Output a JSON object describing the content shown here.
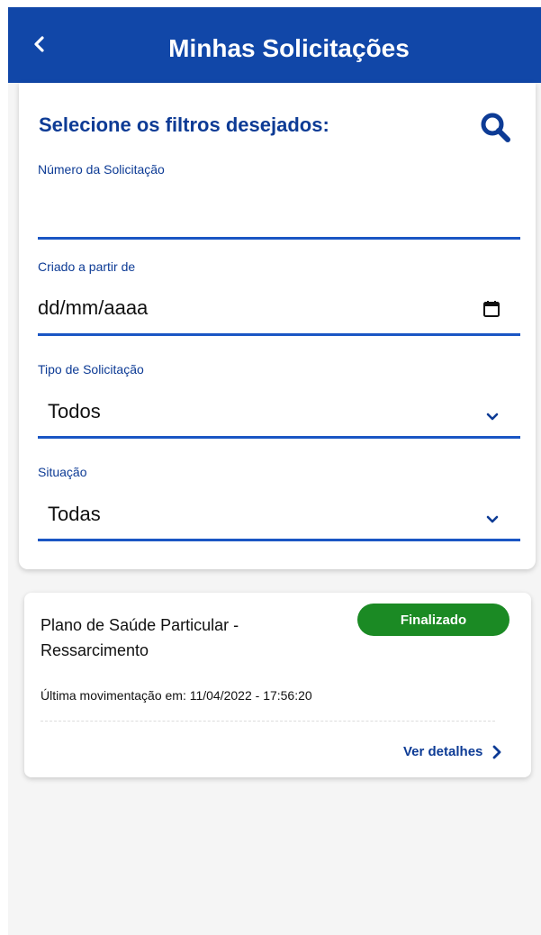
{
  "header": {
    "title": "Minhas Solicitações",
    "back_icon": "chevron-left-icon"
  },
  "filters": {
    "heading": "Selecione os filtros desejados:",
    "search_icon": "search-icon",
    "request_number": {
      "label": "Número da Solicitação",
      "value": ""
    },
    "created_from": {
      "label": "Criado a partir de",
      "value": "dd/mm/aaaa",
      "icon": "calendar-icon"
    },
    "request_type": {
      "label": "Tipo de Solicitação",
      "selected": "Todos",
      "icon": "chevron-down-icon"
    },
    "status": {
      "label": "Situação",
      "selected": "Todas",
      "icon": "chevron-down-icon"
    }
  },
  "requests": [
    {
      "title": "Plano de Saúde Particular - Ressarcimento",
      "status": "Finalizado",
      "last_update": "Última movimentação em: 11/04/2022 - 17:56:20",
      "details_label": "Ver detalhes",
      "details_icon": "chevron-right-icon"
    }
  ],
  "colors": {
    "header_bg": "#1147a8",
    "accent": "#0d3b95",
    "field_line": "#1a56c4",
    "status_finalizado": "#1b8a24",
    "page_bg": "#f5f5f5"
  }
}
